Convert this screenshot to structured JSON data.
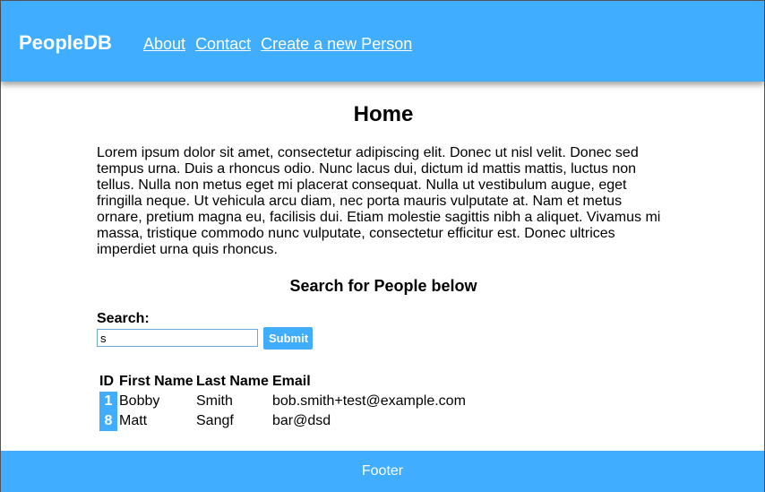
{
  "header": {
    "brand": "PeopleDB",
    "nav": [
      {
        "label": "About"
      },
      {
        "label": "Contact"
      },
      {
        "label": "Create a new Person"
      }
    ]
  },
  "main": {
    "title": "Home",
    "paragraph": "Lorem ipsum dolor sit amet, consectetur adipiscing elit. Donec ut nisl velit. Donec sed tempus urna. Duis a rhoncus odio. Nunc lacus dui, dictum id mattis mattis, luctus non tellus. Nulla non metus eget mi placerat consequat. Nulla ut vestibulum augue, eget fringilla neque. Ut vehicula arcu diam, nec porta mauris vulputate at. Nam et metus ornare, pretium magna eu, facilisis dui. Etiam molestie sagittis nibh a aliquet. Vivamus mi massa, tristique commodo nunc vulputate, consectetur efficitur est. Donec ultrices imperdiet urna quis rhoncus.",
    "search_heading": "Search for People below",
    "search_label": "Search:",
    "search_value": "s",
    "submit_label": "Submit"
  },
  "table": {
    "columns": [
      "ID",
      "First Name",
      "Last Name",
      "Email"
    ],
    "rows": [
      {
        "id": "1",
        "first": "Bobby",
        "last": "Smith",
        "email": "bob.smith+test@example.com"
      },
      {
        "id": "8",
        "first": "Matt",
        "last": "Sangf",
        "email": "bar@dsd"
      }
    ]
  },
  "footer": {
    "text": "Footer"
  },
  "colors": {
    "accent": "#40adff"
  }
}
